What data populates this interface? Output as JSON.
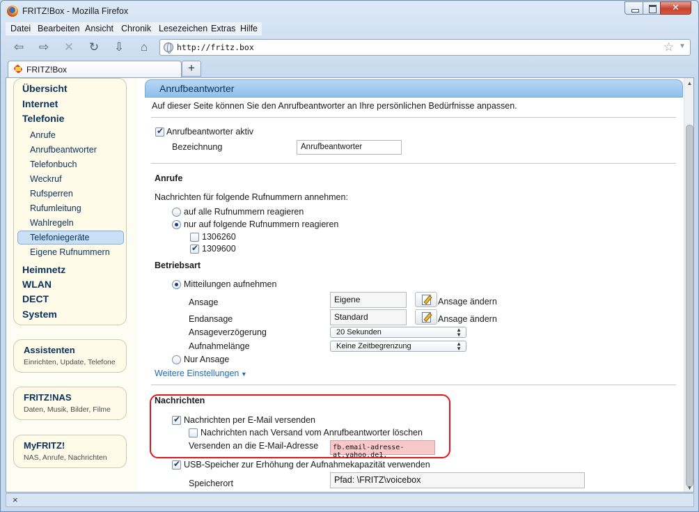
{
  "window": {
    "title": "FRITZ!Box - Mozilla Firefox"
  },
  "menu": [
    "Datei",
    "Bearbeiten",
    "Ansicht",
    "Chronik",
    "Lesezeichen",
    "Extras",
    "Hilfe"
  ],
  "nav": {
    "url": "http://fritz.box"
  },
  "tab": {
    "label": "FRITZ!Box",
    "new_tab": "+"
  },
  "sidebar": {
    "main": [
      "Übersicht",
      "Internet",
      "Telefonie"
    ],
    "telefonie_items": [
      "Anrufe",
      "Anrufbeantworter",
      "Telefonbuch",
      "Weckruf",
      "Rufsperren",
      "Rufumleitung",
      "Wahlregeln",
      "Telefoniegeräte",
      "Eigene Rufnummern"
    ],
    "active_item": "Telefoniegeräte",
    "main_after": [
      "Heimnetz",
      "WLAN",
      "DECT",
      "System"
    ],
    "boxes": [
      {
        "title": "Assistenten",
        "subtitle": "Einrichten, Update, Telefone"
      },
      {
        "title": "FRITZ!NAS",
        "subtitle": "Daten, Musik, Bilder, Filme"
      },
      {
        "title": "MyFRITZ!",
        "subtitle": "NAS, Anrufe, Nachrichten"
      }
    ]
  },
  "page": {
    "title": "Anrufbeantworter",
    "intro": "Auf dieser Seite können Sie den Anrufbeantworter an Ihre persönlichen Bedürfnisse anpassen.",
    "active_label": "Anrufbeantworter aktiv",
    "active_checked": true,
    "name_label": "Bezeichnung",
    "name_value": "Anrufbeantworter",
    "calls": {
      "heading": "Anrufe",
      "desc": "Nachrichten für folgende Rufnummern annehmen:",
      "option_all": "auf alle Rufnummern reagieren",
      "option_some": "nur auf folgende Rufnummern reagieren",
      "selected": "option_some",
      "numbers": [
        {
          "number": "1306260",
          "checked": false
        },
        {
          "number": "1309600",
          "checked": true
        }
      ]
    },
    "mode": {
      "heading": "Betriebsart",
      "option_record": "Mitteilungen aufnehmen",
      "announce_label": "Ansage",
      "announce_value": "Eigene",
      "end_label": "Endansage",
      "end_value": "Standard",
      "change_label": "Ansage ändern",
      "delay_label": "Ansageverzögerung",
      "delay_value": "20 Sekunden",
      "length_label": "Aufnahmelänge",
      "length_value": "Keine Zeitbegrenzung",
      "option_only": "Nur Ansage",
      "selected": "option_record",
      "more_settings": "Weitere Einstellungen"
    },
    "messages": {
      "heading": "Nachrichten",
      "email_label": "Nachrichten per E-Mail versenden",
      "email_checked": true,
      "delete_label": "Nachrichten nach Versand vom Anrufbeantworter löschen",
      "delete_checked": false,
      "address_label": "Versenden an die E-Mail-Adresse",
      "address_value": "fb.email-adresse-at.yahoo.de1.",
      "usb_label": "USB-Speicher zur Erhöhung der Aufnahmekapazität verwenden",
      "usb_checked": true,
      "location_label": "Speicherort",
      "location_value": "Pfad: \\FRITZ\\voicebox"
    }
  },
  "findbar": {
    "close": "×"
  }
}
